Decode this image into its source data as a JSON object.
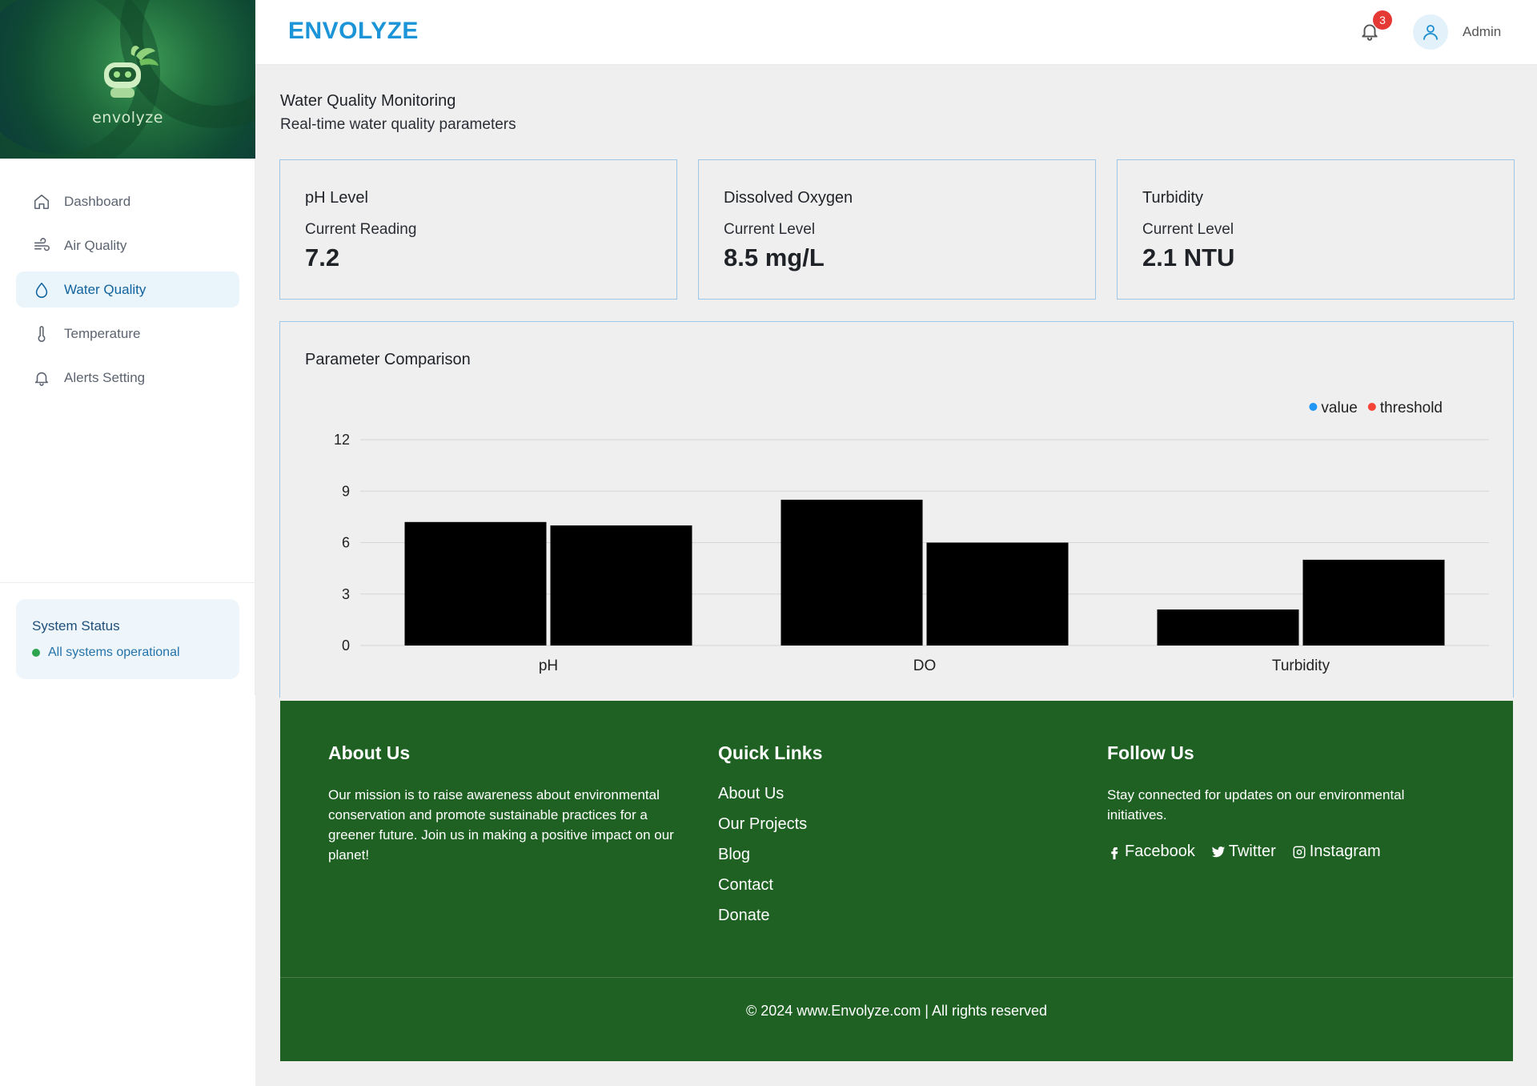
{
  "brand": {
    "logo_text": "envolyze",
    "name": "ENVOLYZE"
  },
  "sidebar": {
    "items": [
      {
        "label": "Dashboard",
        "icon": "home-icon"
      },
      {
        "label": "Air Quality",
        "icon": "wind-icon"
      },
      {
        "label": "Water Quality",
        "icon": "droplet-icon",
        "active": true
      },
      {
        "label": "Temperature",
        "icon": "thermometer-icon"
      },
      {
        "label": "Alerts Setting",
        "icon": "bell-icon"
      }
    ],
    "status": {
      "title": "System Status",
      "text": "All systems operational",
      "color": "#2ea44f"
    }
  },
  "header": {
    "notification_count": "3",
    "user_name": "Admin"
  },
  "page": {
    "title": "Water Quality Monitoring",
    "subtitle": "Real-time water quality parameters"
  },
  "cards": [
    {
      "title": "pH Level",
      "label": "Current Reading",
      "value": "7.2"
    },
    {
      "title": "Dissolved Oxygen",
      "label": "Current Level",
      "value": "8.5 mg/L"
    },
    {
      "title": "Turbidity",
      "label": "Current Level",
      "value": "2.1 NTU"
    }
  ],
  "chart": {
    "title": "Parameter Comparison"
  },
  "chart_data": {
    "type": "bar",
    "categories": [
      "pH",
      "DO",
      "Turbidity"
    ],
    "series": [
      {
        "name": "value",
        "values": [
          7.2,
          8.5,
          2.1
        ],
        "legend_color": "#2196f3",
        "bar_color": "#000000"
      },
      {
        "name": "threshold",
        "values": [
          7.0,
          6.0,
          5.0
        ],
        "legend_color": "#f44336",
        "bar_color": "#000000"
      }
    ],
    "ylim": [
      0,
      12
    ],
    "yticks": [
      0,
      3,
      6,
      9,
      12
    ],
    "grid": true,
    "legend": "top-right"
  },
  "footer": {
    "about": {
      "heading": "About Us",
      "text": "Our mission is to raise awareness about environmental conservation and promote sustainable practices for a greener future. Join us in making a positive impact on our planet!"
    },
    "links": {
      "heading": "Quick Links",
      "items": [
        "About Us",
        "Our Projects",
        "Blog",
        "Contact",
        "Donate"
      ]
    },
    "follow": {
      "heading": "Follow Us",
      "text": "Stay connected for updates on our environmental initiatives.",
      "socials": [
        {
          "label": "Facebook",
          "icon": "facebook-icon"
        },
        {
          "label": "Twitter",
          "icon": "twitter-icon"
        },
        {
          "label": "Instagram",
          "icon": "instagram-icon"
        }
      ]
    },
    "copyright": "© 2024 www.Envolyze.com | All rights reserved"
  },
  "colors": {
    "brand": "#1b94d8",
    "footer_bg": "#1e6122",
    "active_nav_bg": "#eaf4fb",
    "card_border": "#9cc7e8"
  }
}
